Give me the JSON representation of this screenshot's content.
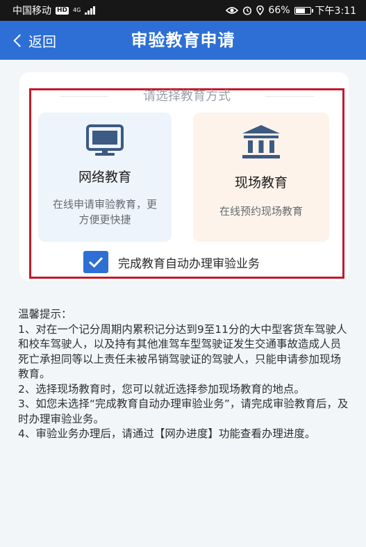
{
  "status_bar": {
    "carrier": "中国移动",
    "hd": "HD",
    "network": "4G",
    "battery": "66%",
    "time": "下午3:11"
  },
  "nav": {
    "back_label": "返回",
    "title": "审验教育申请"
  },
  "selection": {
    "heading": "请选择教育方式",
    "options": [
      {
        "title": "网络教育",
        "description": "在线申请审验教育，更方便更快捷",
        "icon": "monitor-icon"
      },
      {
        "title": "现场教育",
        "description": "在线预约现场教育",
        "icon": "building-icon"
      }
    ],
    "auto_complete": {
      "label": "完成教育自动办理审验业务",
      "checked": true
    }
  },
  "tips": {
    "title": "温馨提示：",
    "items": [
      "1、对在一个记分周期内累积记分达到9至11分的大中型客货车驾驶人和校车驾驶人，以及持有其他准驾车型驾驶证发生交通事故造成人员死亡承担同等以上责任未被吊销驾驶证的驾驶人，只能申请参加现场教育。",
      "2、选择现场教育时，您可以就近选择参加现场教育的地点。",
      "3、如您未选择“完成教育自动办理审验业务”，请完成审验教育后，及时办理审验业务。",
      "4、审验业务办理后，请通过【网办进度】功能查看办理进度。"
    ]
  },
  "colors": {
    "primary": "#2d6fd5",
    "highlight": "#c3192a",
    "online_bg": "#eef4fb",
    "onsite_bg": "#fdf3ea"
  }
}
